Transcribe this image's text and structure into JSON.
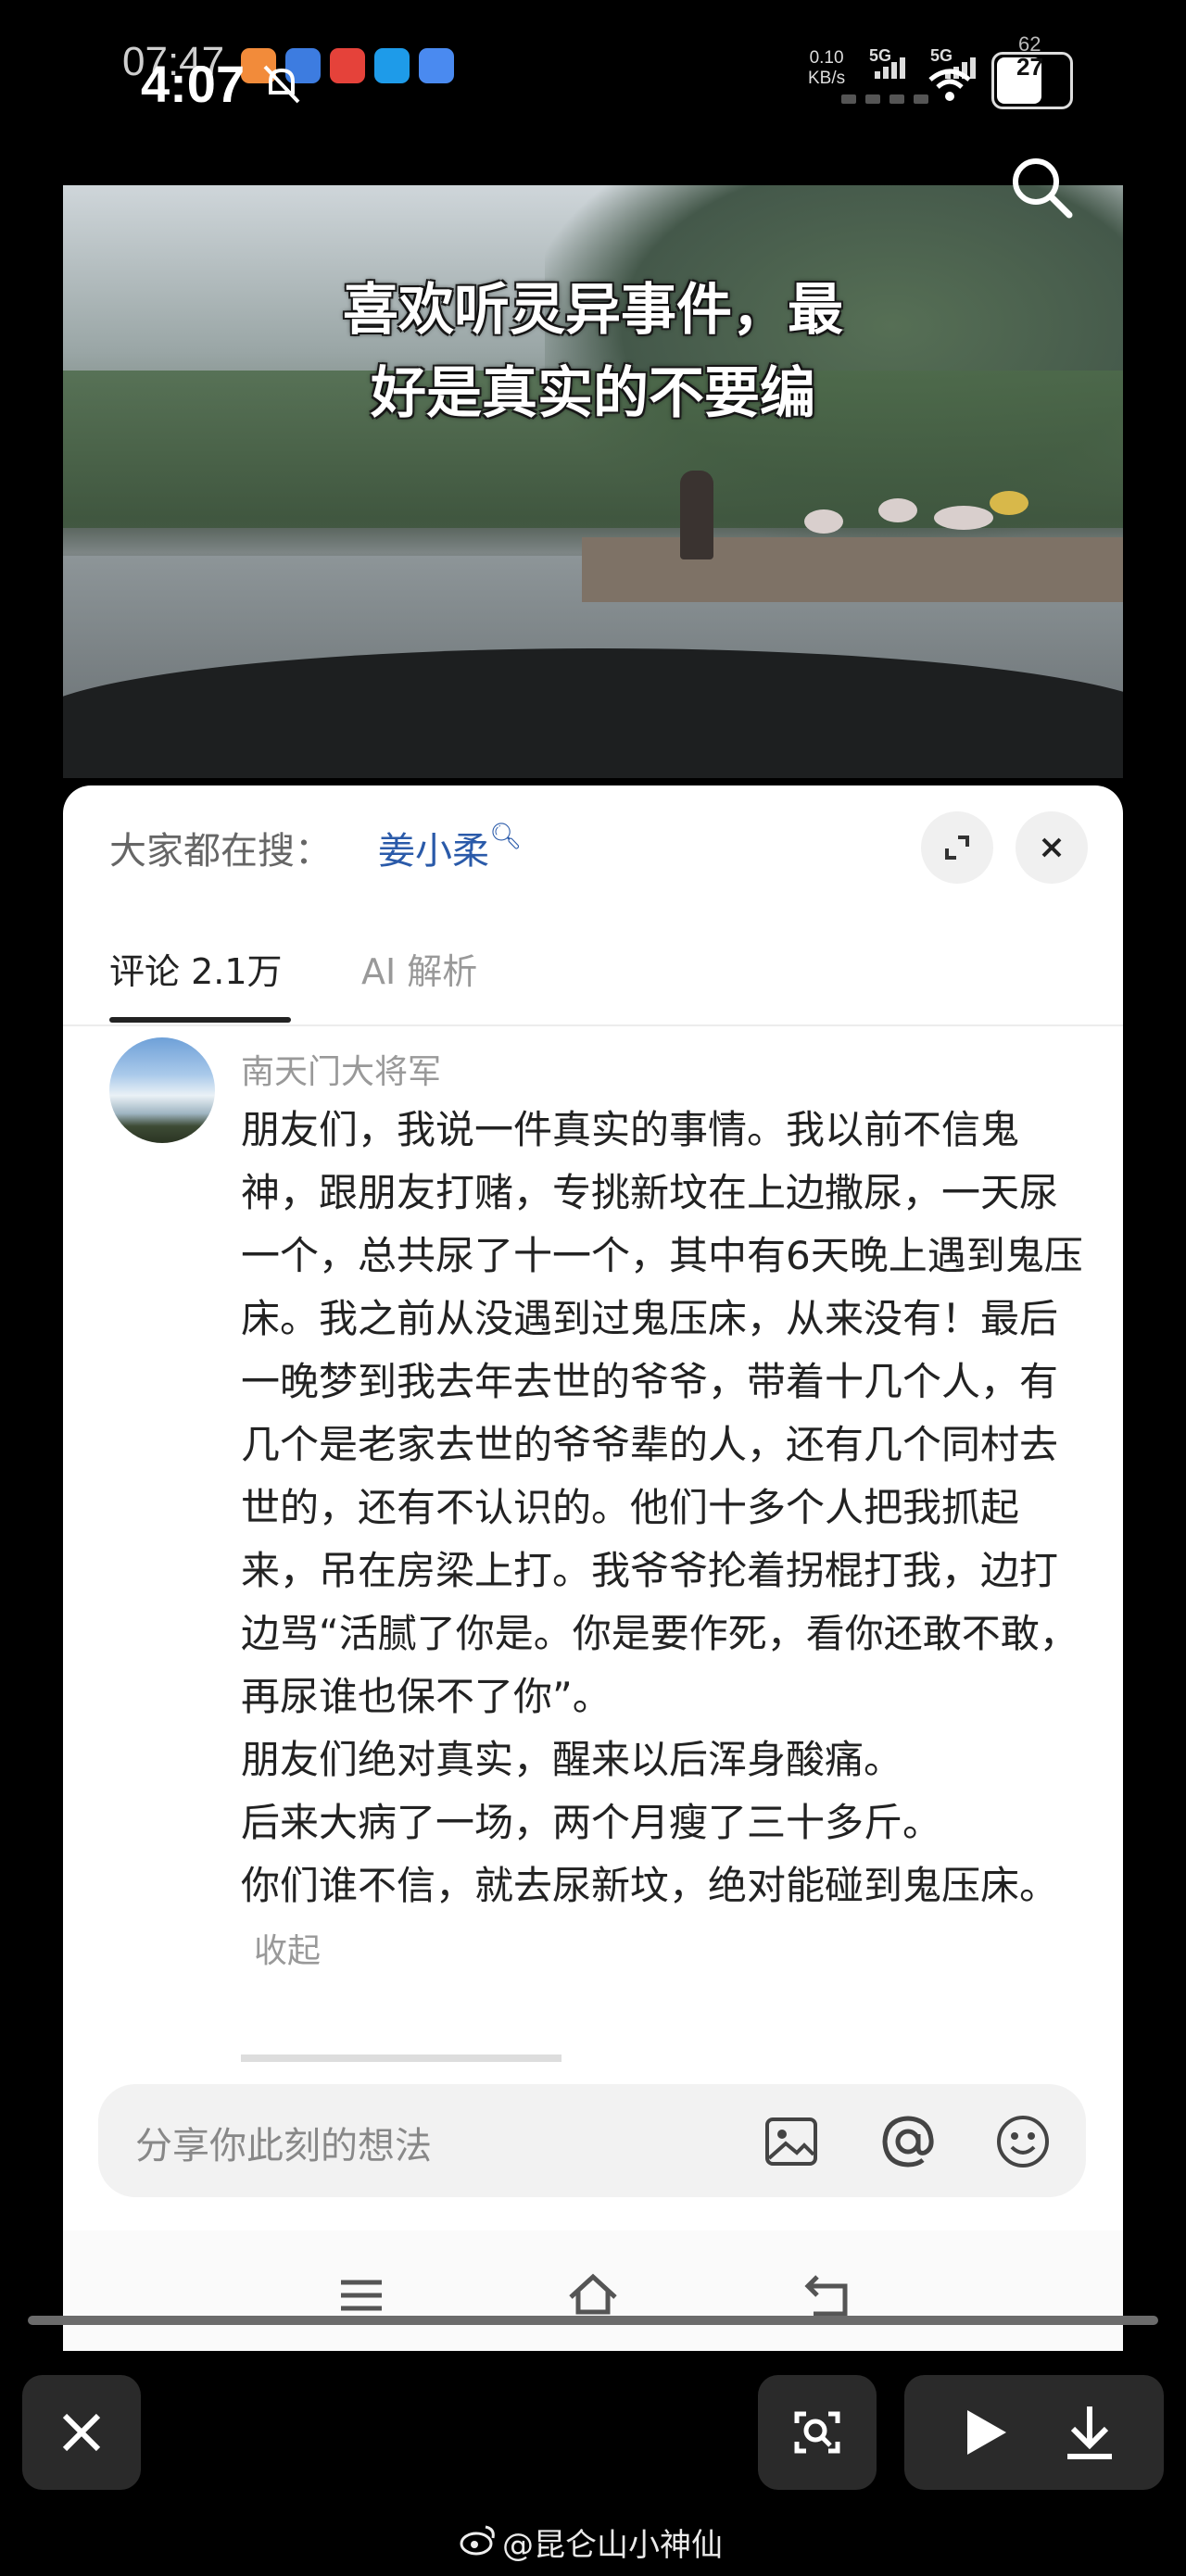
{
  "status_bar": {
    "time_overlay": "07:47",
    "time": "4:07",
    "net_speed_value": "0.10",
    "net_speed_unit": "KB/s",
    "signal1": "5G",
    "signal2": "5G",
    "battery_back": "62",
    "battery": "27"
  },
  "video": {
    "caption_line1": "喜欢听灵异事件，最",
    "caption_line2": "好是真实的不要编"
  },
  "sheet": {
    "hot_search_label": "大家都在搜：",
    "hot_search_term": "姜小柔",
    "tabs": [
      {
        "label": "评论 2.1万"
      },
      {
        "label": "AI 解析"
      }
    ],
    "comment": {
      "username": "南天门大将军",
      "paragraphs": [
        "朋友们，我说一件真实的事情。我以前不信鬼神，跟朋友打赌，专挑新坟在上边撒尿，一天尿一个，总共尿了十一个，其中有6天晚上遇到鬼压床。我之前从没遇到过鬼压床，从来没有！最后一晚梦到我去年去世的爷爷，带着十几个人，有几个是老家去世的爷爷辈的人，还有几个同村去世的，还有不认识的。他们十多个人把我抓起来，吊在房梁上打。我爷爷抡着拐棍打我，边打边骂“活腻了你是。你是要作死，看你还敢不敢，再尿谁也保不了你”。",
        "朋友们绝对真实，醒来以后浑身酸痛。",
        "后来大病了一场，两个月瘦了三十多斤。",
        "你们谁不信，就去尿新坟，绝对能碰到鬼压床。"
      ],
      "collapse_label": "收起"
    },
    "input_placeholder": "分享你此刻的想法"
  },
  "watermark": "@昆仑山小神仙"
}
